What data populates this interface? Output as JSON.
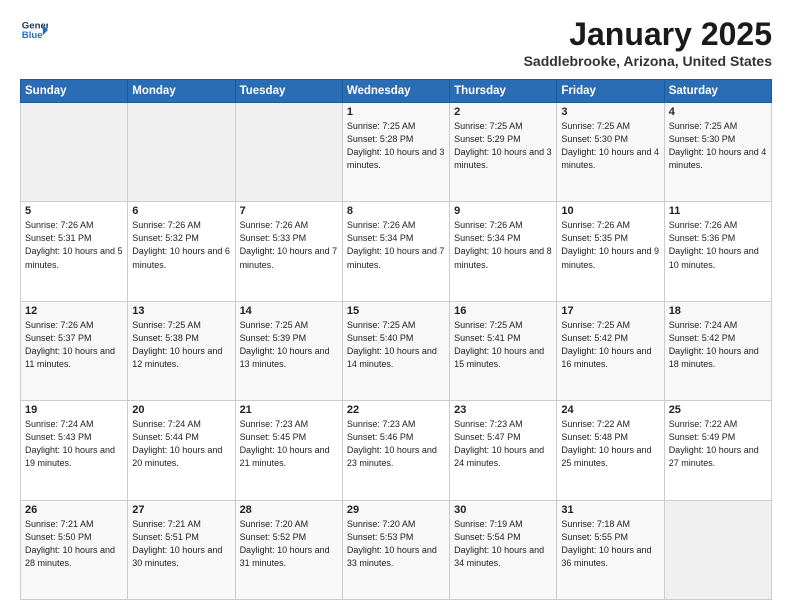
{
  "header": {
    "logo_line1": "General",
    "logo_line2": "Blue",
    "month": "January 2025",
    "location": "Saddlebrooke, Arizona, United States"
  },
  "weekdays": [
    "Sunday",
    "Monday",
    "Tuesday",
    "Wednesday",
    "Thursday",
    "Friday",
    "Saturday"
  ],
  "weeks": [
    [
      {
        "day": "",
        "sunrise": "",
        "sunset": "",
        "daylight": ""
      },
      {
        "day": "",
        "sunrise": "",
        "sunset": "",
        "daylight": ""
      },
      {
        "day": "",
        "sunrise": "",
        "sunset": "",
        "daylight": ""
      },
      {
        "day": "1",
        "sunrise": "Sunrise: 7:25 AM",
        "sunset": "Sunset: 5:28 PM",
        "daylight": "Daylight: 10 hours and 3 minutes."
      },
      {
        "day": "2",
        "sunrise": "Sunrise: 7:25 AM",
        "sunset": "Sunset: 5:29 PM",
        "daylight": "Daylight: 10 hours and 3 minutes."
      },
      {
        "day": "3",
        "sunrise": "Sunrise: 7:25 AM",
        "sunset": "Sunset: 5:30 PM",
        "daylight": "Daylight: 10 hours and 4 minutes."
      },
      {
        "day": "4",
        "sunrise": "Sunrise: 7:25 AM",
        "sunset": "Sunset: 5:30 PM",
        "daylight": "Daylight: 10 hours and 4 minutes."
      }
    ],
    [
      {
        "day": "5",
        "sunrise": "Sunrise: 7:26 AM",
        "sunset": "Sunset: 5:31 PM",
        "daylight": "Daylight: 10 hours and 5 minutes."
      },
      {
        "day": "6",
        "sunrise": "Sunrise: 7:26 AM",
        "sunset": "Sunset: 5:32 PM",
        "daylight": "Daylight: 10 hours and 6 minutes."
      },
      {
        "day": "7",
        "sunrise": "Sunrise: 7:26 AM",
        "sunset": "Sunset: 5:33 PM",
        "daylight": "Daylight: 10 hours and 7 minutes."
      },
      {
        "day": "8",
        "sunrise": "Sunrise: 7:26 AM",
        "sunset": "Sunset: 5:34 PM",
        "daylight": "Daylight: 10 hours and 7 minutes."
      },
      {
        "day": "9",
        "sunrise": "Sunrise: 7:26 AM",
        "sunset": "Sunset: 5:34 PM",
        "daylight": "Daylight: 10 hours and 8 minutes."
      },
      {
        "day": "10",
        "sunrise": "Sunrise: 7:26 AM",
        "sunset": "Sunset: 5:35 PM",
        "daylight": "Daylight: 10 hours and 9 minutes."
      },
      {
        "day": "11",
        "sunrise": "Sunrise: 7:26 AM",
        "sunset": "Sunset: 5:36 PM",
        "daylight": "Daylight: 10 hours and 10 minutes."
      }
    ],
    [
      {
        "day": "12",
        "sunrise": "Sunrise: 7:26 AM",
        "sunset": "Sunset: 5:37 PM",
        "daylight": "Daylight: 10 hours and 11 minutes."
      },
      {
        "day": "13",
        "sunrise": "Sunrise: 7:25 AM",
        "sunset": "Sunset: 5:38 PM",
        "daylight": "Daylight: 10 hours and 12 minutes."
      },
      {
        "day": "14",
        "sunrise": "Sunrise: 7:25 AM",
        "sunset": "Sunset: 5:39 PM",
        "daylight": "Daylight: 10 hours and 13 minutes."
      },
      {
        "day": "15",
        "sunrise": "Sunrise: 7:25 AM",
        "sunset": "Sunset: 5:40 PM",
        "daylight": "Daylight: 10 hours and 14 minutes."
      },
      {
        "day": "16",
        "sunrise": "Sunrise: 7:25 AM",
        "sunset": "Sunset: 5:41 PM",
        "daylight": "Daylight: 10 hours and 15 minutes."
      },
      {
        "day": "17",
        "sunrise": "Sunrise: 7:25 AM",
        "sunset": "Sunset: 5:42 PM",
        "daylight": "Daylight: 10 hours and 16 minutes."
      },
      {
        "day": "18",
        "sunrise": "Sunrise: 7:24 AM",
        "sunset": "Sunset: 5:42 PM",
        "daylight": "Daylight: 10 hours and 18 minutes."
      }
    ],
    [
      {
        "day": "19",
        "sunrise": "Sunrise: 7:24 AM",
        "sunset": "Sunset: 5:43 PM",
        "daylight": "Daylight: 10 hours and 19 minutes."
      },
      {
        "day": "20",
        "sunrise": "Sunrise: 7:24 AM",
        "sunset": "Sunset: 5:44 PM",
        "daylight": "Daylight: 10 hours and 20 minutes."
      },
      {
        "day": "21",
        "sunrise": "Sunrise: 7:23 AM",
        "sunset": "Sunset: 5:45 PM",
        "daylight": "Daylight: 10 hours and 21 minutes."
      },
      {
        "day": "22",
        "sunrise": "Sunrise: 7:23 AM",
        "sunset": "Sunset: 5:46 PM",
        "daylight": "Daylight: 10 hours and 23 minutes."
      },
      {
        "day": "23",
        "sunrise": "Sunrise: 7:23 AM",
        "sunset": "Sunset: 5:47 PM",
        "daylight": "Daylight: 10 hours and 24 minutes."
      },
      {
        "day": "24",
        "sunrise": "Sunrise: 7:22 AM",
        "sunset": "Sunset: 5:48 PM",
        "daylight": "Daylight: 10 hours and 25 minutes."
      },
      {
        "day": "25",
        "sunrise": "Sunrise: 7:22 AM",
        "sunset": "Sunset: 5:49 PM",
        "daylight": "Daylight: 10 hours and 27 minutes."
      }
    ],
    [
      {
        "day": "26",
        "sunrise": "Sunrise: 7:21 AM",
        "sunset": "Sunset: 5:50 PM",
        "daylight": "Daylight: 10 hours and 28 minutes."
      },
      {
        "day": "27",
        "sunrise": "Sunrise: 7:21 AM",
        "sunset": "Sunset: 5:51 PM",
        "daylight": "Daylight: 10 hours and 30 minutes."
      },
      {
        "day": "28",
        "sunrise": "Sunrise: 7:20 AM",
        "sunset": "Sunset: 5:52 PM",
        "daylight": "Daylight: 10 hours and 31 minutes."
      },
      {
        "day": "29",
        "sunrise": "Sunrise: 7:20 AM",
        "sunset": "Sunset: 5:53 PM",
        "daylight": "Daylight: 10 hours and 33 minutes."
      },
      {
        "day": "30",
        "sunrise": "Sunrise: 7:19 AM",
        "sunset": "Sunset: 5:54 PM",
        "daylight": "Daylight: 10 hours and 34 minutes."
      },
      {
        "day": "31",
        "sunrise": "Sunrise: 7:18 AM",
        "sunset": "Sunset: 5:55 PM",
        "daylight": "Daylight: 10 hours and 36 minutes."
      },
      {
        "day": "",
        "sunrise": "",
        "sunset": "",
        "daylight": ""
      }
    ]
  ]
}
